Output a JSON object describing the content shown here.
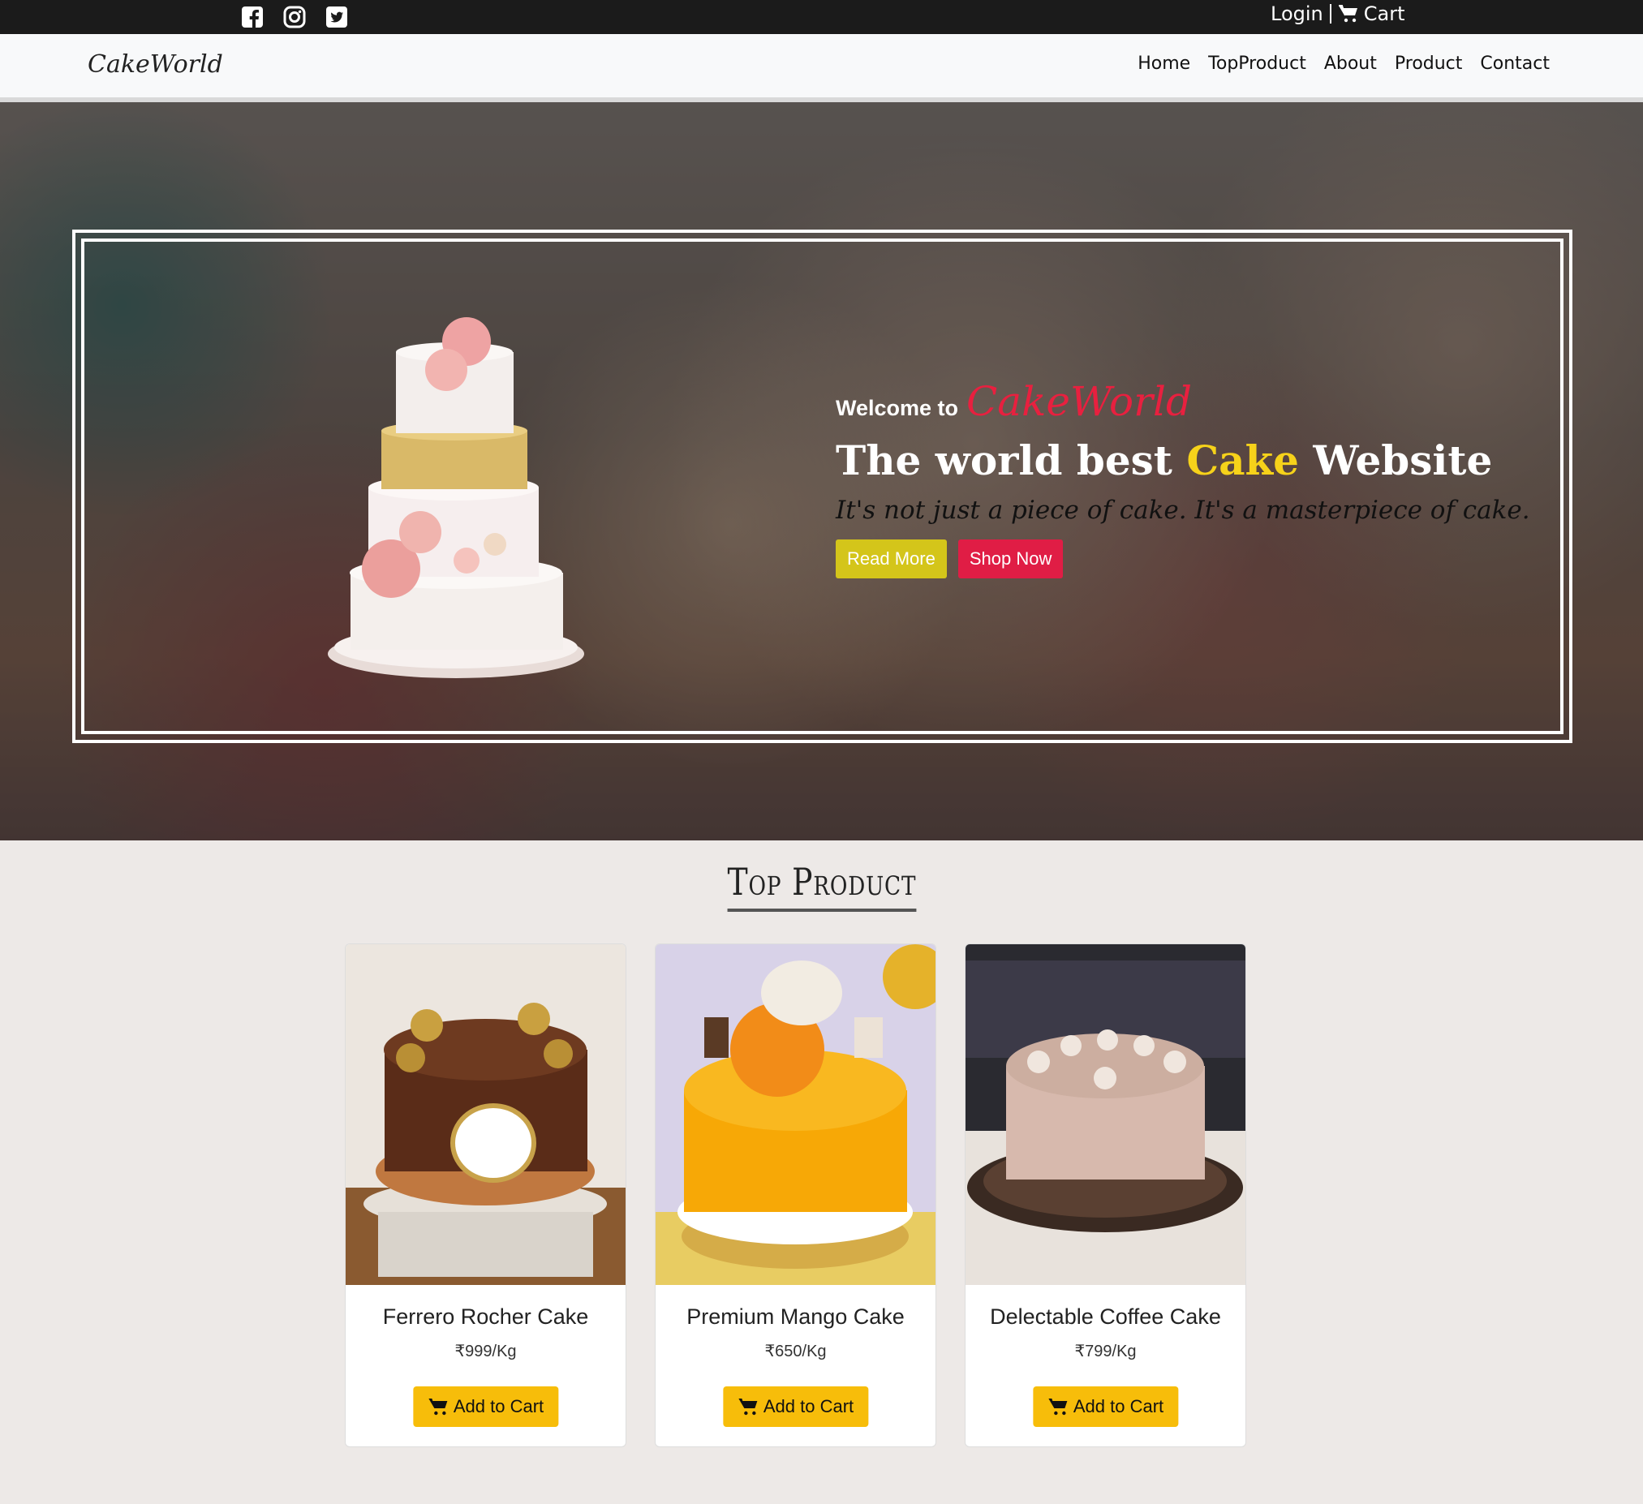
{
  "topbar": {
    "social_icons": [
      "facebook-icon",
      "instagram-icon",
      "twitter-icon"
    ],
    "login_label": "Login",
    "cart_label": "Cart"
  },
  "navbar": {
    "brand": "CakeWorld",
    "links": [
      "Home",
      "TopProduct",
      "About",
      "Product",
      "Contact"
    ]
  },
  "hero": {
    "welcome_prefix": "Welcome to",
    "welcome_brand": "CakeWorld",
    "headline_before": "The world best ",
    "headline_accent": "Cake",
    "headline_after": " Website",
    "tagline": "It's not just a piece of cake. It's a masterpiece of cake.",
    "read_more_label": "Read More",
    "shop_now_label": "Shop Now"
  },
  "top_product": {
    "title": "Top Product",
    "products": [
      {
        "name": "Ferrero Rocher Cake",
        "price": "₹999/Kg",
        "button": "Add to Cart"
      },
      {
        "name": "Premium Mango Cake",
        "price": "₹650/Kg",
        "button": "Add to Cart"
      },
      {
        "name": "Delectable Coffee Cake",
        "price": "₹799/Kg",
        "button": "Add to Cart"
      }
    ]
  },
  "colors": {
    "topbar": "#1b1b1b",
    "brand_red": "#e01d45",
    "accent_yellow": "#f6d21a",
    "read_more": "#d4c51a",
    "add_to_cart": "#f7bd0a",
    "page_bg": "#ede9e7"
  }
}
